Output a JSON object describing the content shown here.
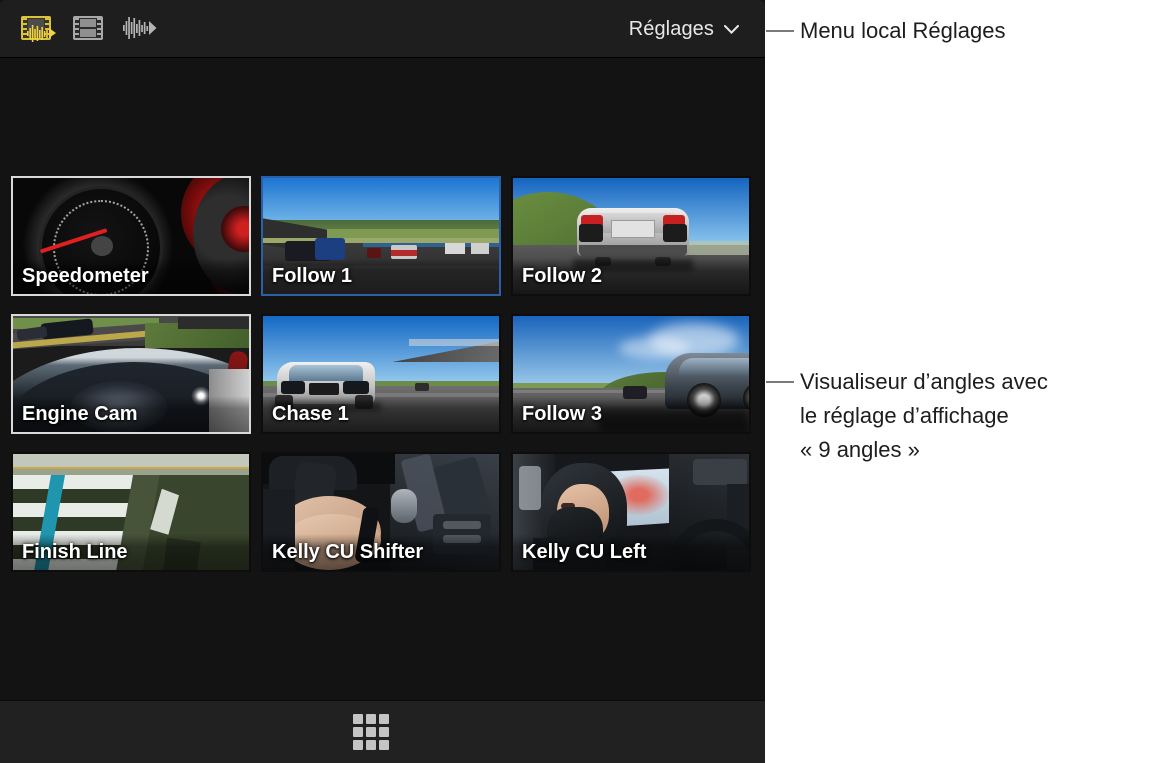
{
  "viewer": {
    "toolbar": {
      "icons": [
        {
          "name": "video-and-audio-icon",
          "label": "Vidéo et audio",
          "active": true
        },
        {
          "name": "video-only-icon",
          "label": "Vidéo seulement",
          "active": false
        },
        {
          "name": "audio-only-icon",
          "label": "Audio seulement",
          "active": false
        }
      ],
      "settings_label": "Réglages",
      "chevron": "chevron-down-icon"
    },
    "angles": [
      {
        "name": "Speedometer",
        "selection": "white",
        "scene": "speedometer"
      },
      {
        "name": "Follow 1",
        "selection": "blue",
        "scene": "track-cars"
      },
      {
        "name": "Follow 2",
        "selection": "none",
        "scene": "car-rear"
      },
      {
        "name": "Engine Cam",
        "selection": "white",
        "scene": "engine-cam"
      },
      {
        "name": "Chase 1",
        "selection": "none",
        "scene": "car-front"
      },
      {
        "name": "Follow 3",
        "selection": "none",
        "scene": "track-wide"
      },
      {
        "name": "Finish Line",
        "selection": "none",
        "scene": "finish-line"
      },
      {
        "name": "Kelly CU Shifter",
        "selection": "none",
        "scene": "shifter"
      },
      {
        "name": "Kelly CU Left",
        "selection": "none",
        "scene": "driver"
      }
    ],
    "bottom_bar": {
      "grid_button_name": "grid-3x3-icon",
      "grid_cells": [
        1,
        2,
        3,
        4,
        5,
        6,
        7,
        8,
        9
      ]
    }
  },
  "callouts": {
    "settings": "Menu local Réglages",
    "viewer": "Visualiseur d’angles avec\nle réglage d’affichage\n« 9 angles »"
  },
  "colors": {
    "panel_background": "#131313",
    "toolbar_background": "#1e1e1e",
    "bottom_bar_background": "#212121",
    "active_icon": "#d8c33a",
    "inactive_icon": "#a8a8a8",
    "selection_white": "#d9d9d9",
    "selection_blue": "#2d5fa8",
    "label_text": "#ffffff",
    "callout_text": "#1d1d1d",
    "callout_line": "#7a7a7a"
  }
}
